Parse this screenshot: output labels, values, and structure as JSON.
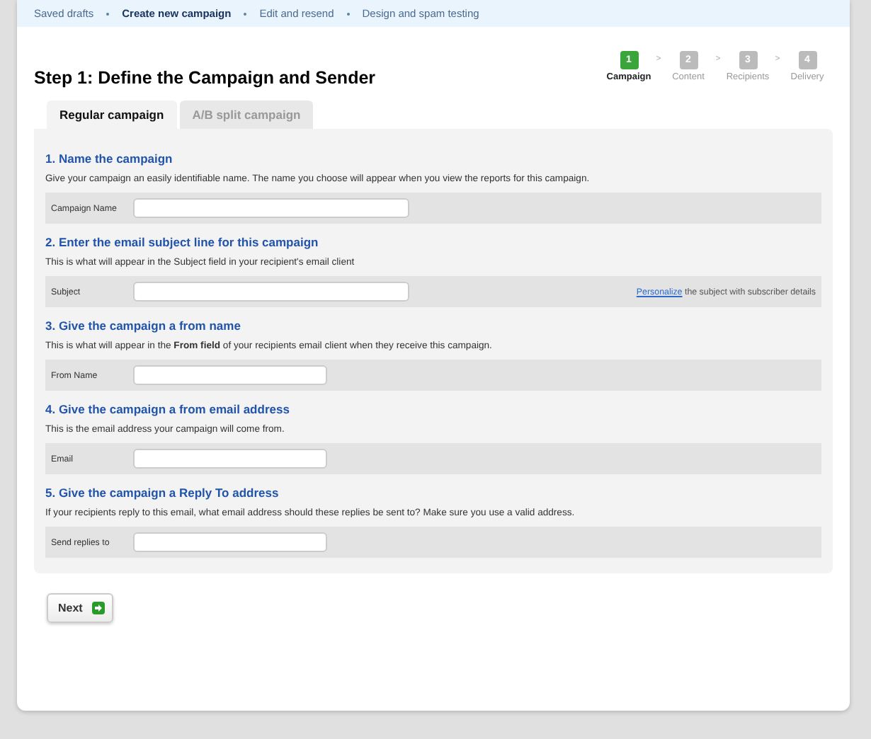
{
  "breadcrumbs": [
    {
      "label": "Saved drafts",
      "selected": false
    },
    {
      "label": "Create new campaign",
      "selected": true
    },
    {
      "label": "Edit and resend",
      "selected": false
    },
    {
      "label": "Design and spam testing",
      "selected": false
    }
  ],
  "title": "Step 1: Define the Campaign and Sender",
  "steps": [
    {
      "number": "1",
      "label": "Campaign",
      "selected": true
    },
    {
      "number": "2",
      "label": "Content",
      "selected": false
    },
    {
      "number": "3",
      "label": "Recipients",
      "selected": false
    },
    {
      "number": "4",
      "label": "Delivery",
      "selected": false
    }
  ],
  "step_separator": ">",
  "tabs": [
    {
      "label": "Regular campaign",
      "selected": true
    },
    {
      "label": "A/B split campaign",
      "selected": false
    }
  ],
  "sections": [
    {
      "heading": "1. Name the campaign",
      "description": "Give your campaign an easily identifiable name. The name you choose will appear when you view the reports for this campaign.",
      "field_label": "Campaign Name",
      "kind": "long"
    },
    {
      "heading": "2. Enter the email subject line for this campaign",
      "description": "This is what will appear in the Subject field in your recipient's email client",
      "field_label": "Subject",
      "kind": "long",
      "hint_link": "Personalize",
      "hint_text": "the subject with subscriber details"
    },
    {
      "heading": "3. Give the campaign a from name",
      "description": "This is what will appear in the **From field** of your recipients email client when they receive this campaign.",
      "field_label": "From Name",
      "kind": "short"
    },
    {
      "heading": "4. Give the campaign a from email address",
      "description": "This is the email address your campaign will come from.",
      "field_label": "Email",
      "kind": "short"
    },
    {
      "heading": "5. Give the campaign a Reply To address",
      "description": "If your recipients reply to this email, what email address should these replies be sent to? Make sure you use a valid address.",
      "field_label": "Send replies to",
      "kind": "short"
    }
  ],
  "next_button": "Next"
}
